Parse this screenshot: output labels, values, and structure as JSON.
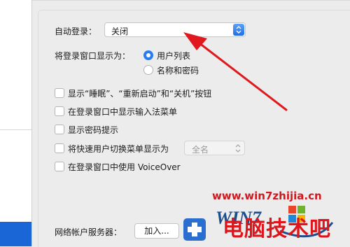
{
  "settings": {
    "auto_login_label": "自动登录：",
    "auto_login_value": "关闭",
    "display_as_label": "将登录窗口显示为：",
    "radio_user_list": "用户列表",
    "radio_name_password": "名称和密码",
    "opt_show_buttons": "显示“睡眠”、“重新启动”和“关机”按钮",
    "opt_input_menu": "在登录窗口中显示输入法菜单",
    "opt_password_hint": "显示密码提示",
    "opt_fast_switch": "将快速用户切换菜单显示为",
    "fast_switch_value": "全名",
    "opt_voiceover": "在登录窗口中使用 VoiceOver",
    "network_server_label": "网络帐户服务器：",
    "join_button": "加入..."
  },
  "watermark": {
    "site": "www.win7zhijia.cn",
    "logo_text": "WIN7",
    "brand": "电脑技术吧"
  },
  "colors": {
    "accent": "#2a7cf2",
    "annotation_arrow": "#e0191f",
    "selection": "#1a66d6"
  },
  "icons": [
    "stepper-arrows-icon",
    "chevron-updown-icon",
    "annotation-arrow-icon",
    "windows-logo-icon",
    "add-icon"
  ]
}
